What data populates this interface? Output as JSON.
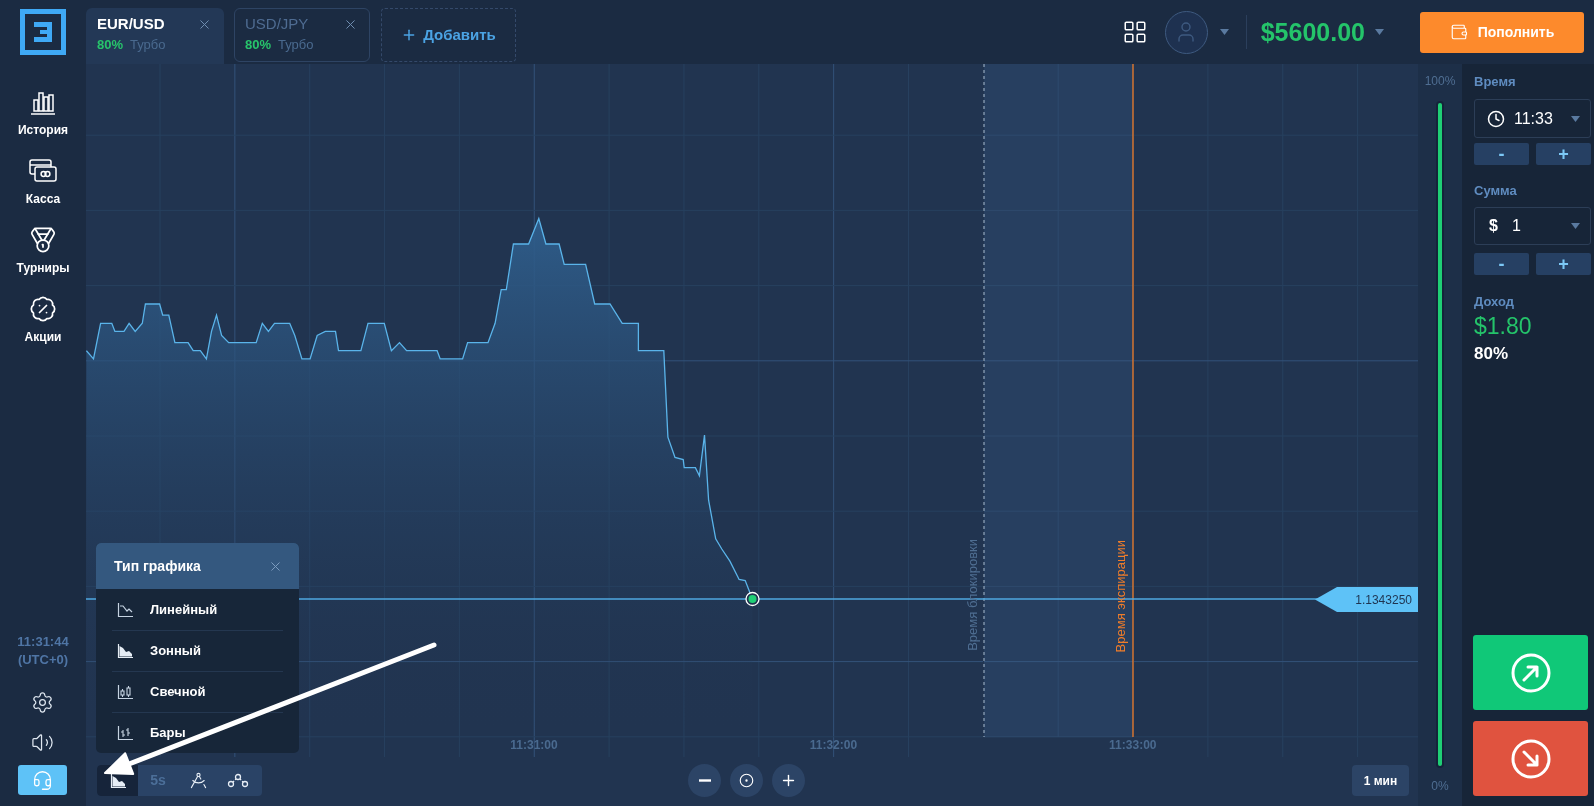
{
  "header": {
    "asset_tabs": [
      {
        "pair": "EUR/USD",
        "payout": "80%",
        "mode": "Турбо",
        "selected": true
      },
      {
        "pair": "USD/JPY",
        "payout": "80%",
        "mode": "Турбо",
        "selected": false
      }
    ],
    "add_button": "Добавить",
    "balance": "$5600.00",
    "deposit_button": "Пополнить"
  },
  "sidebar": {
    "items": [
      {
        "label": "История"
      },
      {
        "label": "Касса"
      },
      {
        "label": "Турниры"
      },
      {
        "label": "Акции"
      }
    ],
    "clock": {
      "time": "11:31:44",
      "zone": "(UTC+0)"
    }
  },
  "chart": {
    "time_labels": [
      "11:31:00",
      "11:32:00",
      "11:33:00"
    ],
    "lock_label": "Время блокировки",
    "expiry_label": "Время экспирации",
    "current_price": "1.1343250",
    "chart_type_menu": {
      "title": "Тип графика",
      "options": [
        "Линейный",
        "Зонный",
        "Свечной",
        "Бары"
      ]
    },
    "toolbar": {
      "chart_type_active": true,
      "interval": "5s"
    },
    "timeframe": "1 мин"
  },
  "sentiment": {
    "top_label": "100%",
    "level": 1,
    "bottom_label": "0%"
  },
  "trade_panel": {
    "time": {
      "label": "Время",
      "value": "11:33",
      "step_buttons": [
        "-",
        "+"
      ]
    },
    "amount": {
      "label": "Сумма",
      "currency": "$",
      "value": "1",
      "step_buttons": [
        "-",
        "+"
      ]
    },
    "income": {
      "label": "Доход",
      "value": "$1.80",
      "percent": "80%"
    }
  }
}
